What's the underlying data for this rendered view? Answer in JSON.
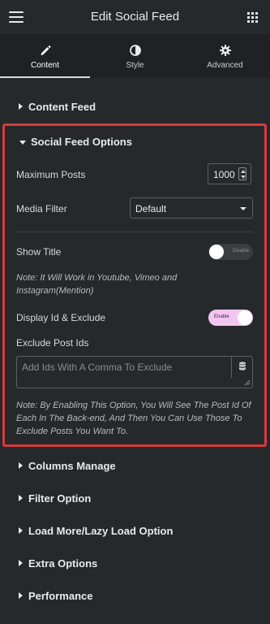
{
  "header": {
    "title": "Edit Social Feed",
    "menu_icon": "hamburger-icon",
    "apps_icon": "grid-icon"
  },
  "tabs": [
    {
      "label": "Content",
      "icon": "pencil-icon",
      "active": true
    },
    {
      "label": "Style",
      "icon": "half-circle-icon",
      "active": false
    },
    {
      "label": "Advanced",
      "icon": "gear-icon",
      "active": false
    }
  ],
  "sections": {
    "content_feed": "Content Feed",
    "columns_manage": "Columns Manage",
    "filter_option": "Filter Option",
    "load_more": "Load More/Lazy Load Option",
    "extra_options": "Extra Options",
    "performance": "Performance"
  },
  "social_feed_options": {
    "title": "Social Feed Options",
    "maximum_posts_label": "Maximum Posts",
    "maximum_posts_value": "1000",
    "media_filter_label": "Media Filter",
    "media_filter_value": "Default",
    "show_title_label": "Show Title",
    "show_title_state": "Disable",
    "show_title_note": "Note: It Will Work in Youtube, Vimeo and Instagram(Mention)",
    "display_id_label": "Display Id & Exclude",
    "display_id_state": "Enable",
    "exclude_label": "Exclude Post Ids",
    "exclude_placeholder": "Add Ids With A Comma To Exclude",
    "exclude_note": "Note: By Enabling This Option, You Will See The Post Id Of Each In The Back-end, And Then You Can Use Those To Exclude Posts You Want To."
  },
  "colors": {
    "highlight_border": "#d63b3b",
    "toggle_on": "#f3c6f1",
    "background": "#26292c"
  }
}
